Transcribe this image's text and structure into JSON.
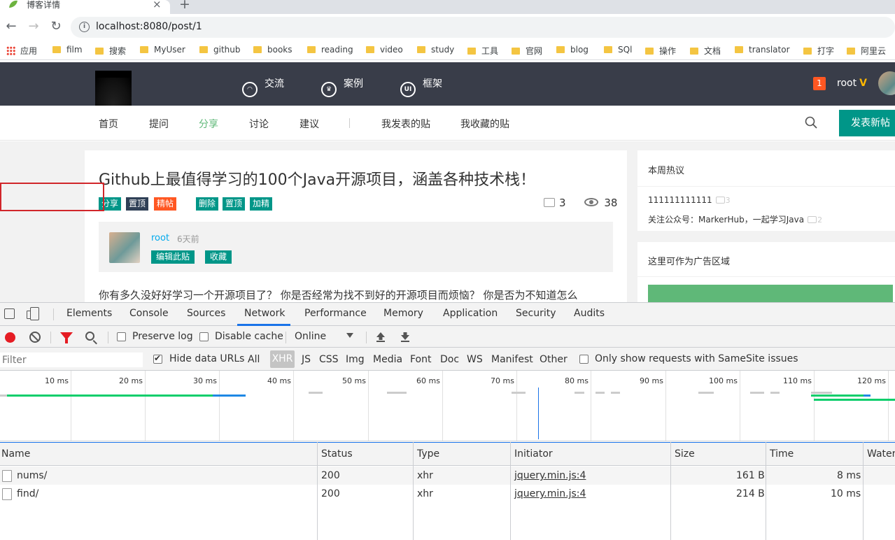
{
  "browser": {
    "tab_title": "博客详情",
    "url": "localhost:8080/post/1",
    "bookmarks": [
      "应用",
      "film",
      "搜索",
      "MyUser",
      "github",
      "books",
      "reading",
      "video",
      "study",
      "工具",
      "官网",
      "blog",
      "SQl",
      "操作",
      "文档",
      "translator",
      "打字",
      "阿里云"
    ]
  },
  "site": {
    "top_nav": [
      "交流",
      "案例",
      "框架"
    ],
    "notification_count": "1",
    "username": "root",
    "sub_nav": [
      "首页",
      "提问",
      "分享",
      "讨论",
      "建议",
      "我发表的贴",
      "我收藏的贴"
    ],
    "post_button": "发表新帖"
  },
  "post": {
    "title": "Github上最值得学习的100个Java开源项目，涵盖各种技术栈！",
    "tags": [
      "分享",
      "置顶",
      "精帖",
      "删除",
      "置顶",
      "加精"
    ],
    "comments": "3",
    "views": "38",
    "author": "root",
    "time": "6天前",
    "edit_button": "编辑此贴",
    "favorite_button": "收藏",
    "excerpt": "你有多久没好好学习一个开源项目了？ 你是否经常为找不到好的开源项目而烦恼？ 你是否为不知道怎么"
  },
  "sidebar": {
    "hot_title": "本周热议",
    "hot_items": [
      {
        "text": "111111111111",
        "count": "3"
      },
      {
        "text": "关注公众号：MarkerHub，一起学习Java",
        "count": "2"
      }
    ],
    "ad_title": "这里可作为广告区域"
  },
  "devtools": {
    "tabs": [
      "Elements",
      "Console",
      "Sources",
      "Network",
      "Performance",
      "Memory",
      "Application",
      "Security",
      "Audits"
    ],
    "active_tab": "Network",
    "preserve_log": "Preserve log",
    "disable_cache": "Disable cache",
    "throttle": "Online",
    "filter_placeholder": "Filter",
    "hide_data_urls": "Hide data URLs",
    "types": [
      "All",
      "XHR",
      "JS",
      "CSS",
      "Img",
      "Media",
      "Font",
      "Doc",
      "WS",
      "Manifest",
      "Other"
    ],
    "samesite": "Only show requests with SameSite issues",
    "timeline_labels": [
      "10 ms",
      "20 ms",
      "30 ms",
      "40 ms",
      "50 ms",
      "60 ms",
      "70 ms",
      "80 ms",
      "90 ms",
      "100 ms",
      "110 ms",
      "120 ms"
    ],
    "columns": [
      "Name",
      "Status",
      "Type",
      "Initiator",
      "Size",
      "Time",
      "Water"
    ],
    "requests": [
      {
        "name": "nums/",
        "status": "200",
        "type": "xhr",
        "initiator": "jquery.min.js:4",
        "size": "161 B",
        "time": "8 ms"
      },
      {
        "name": "find/",
        "status": "200",
        "type": "xhr",
        "initiator": "jquery.min.js:4",
        "size": "214 B",
        "time": "10 ms"
      }
    ]
  },
  "colors": {
    "header_bg": "#393d49",
    "teal": "#009688",
    "orange": "#ff5722",
    "green": "#5fb878",
    "devtools_blue": "#1a73e8",
    "highlight_red": "#d1262a"
  }
}
